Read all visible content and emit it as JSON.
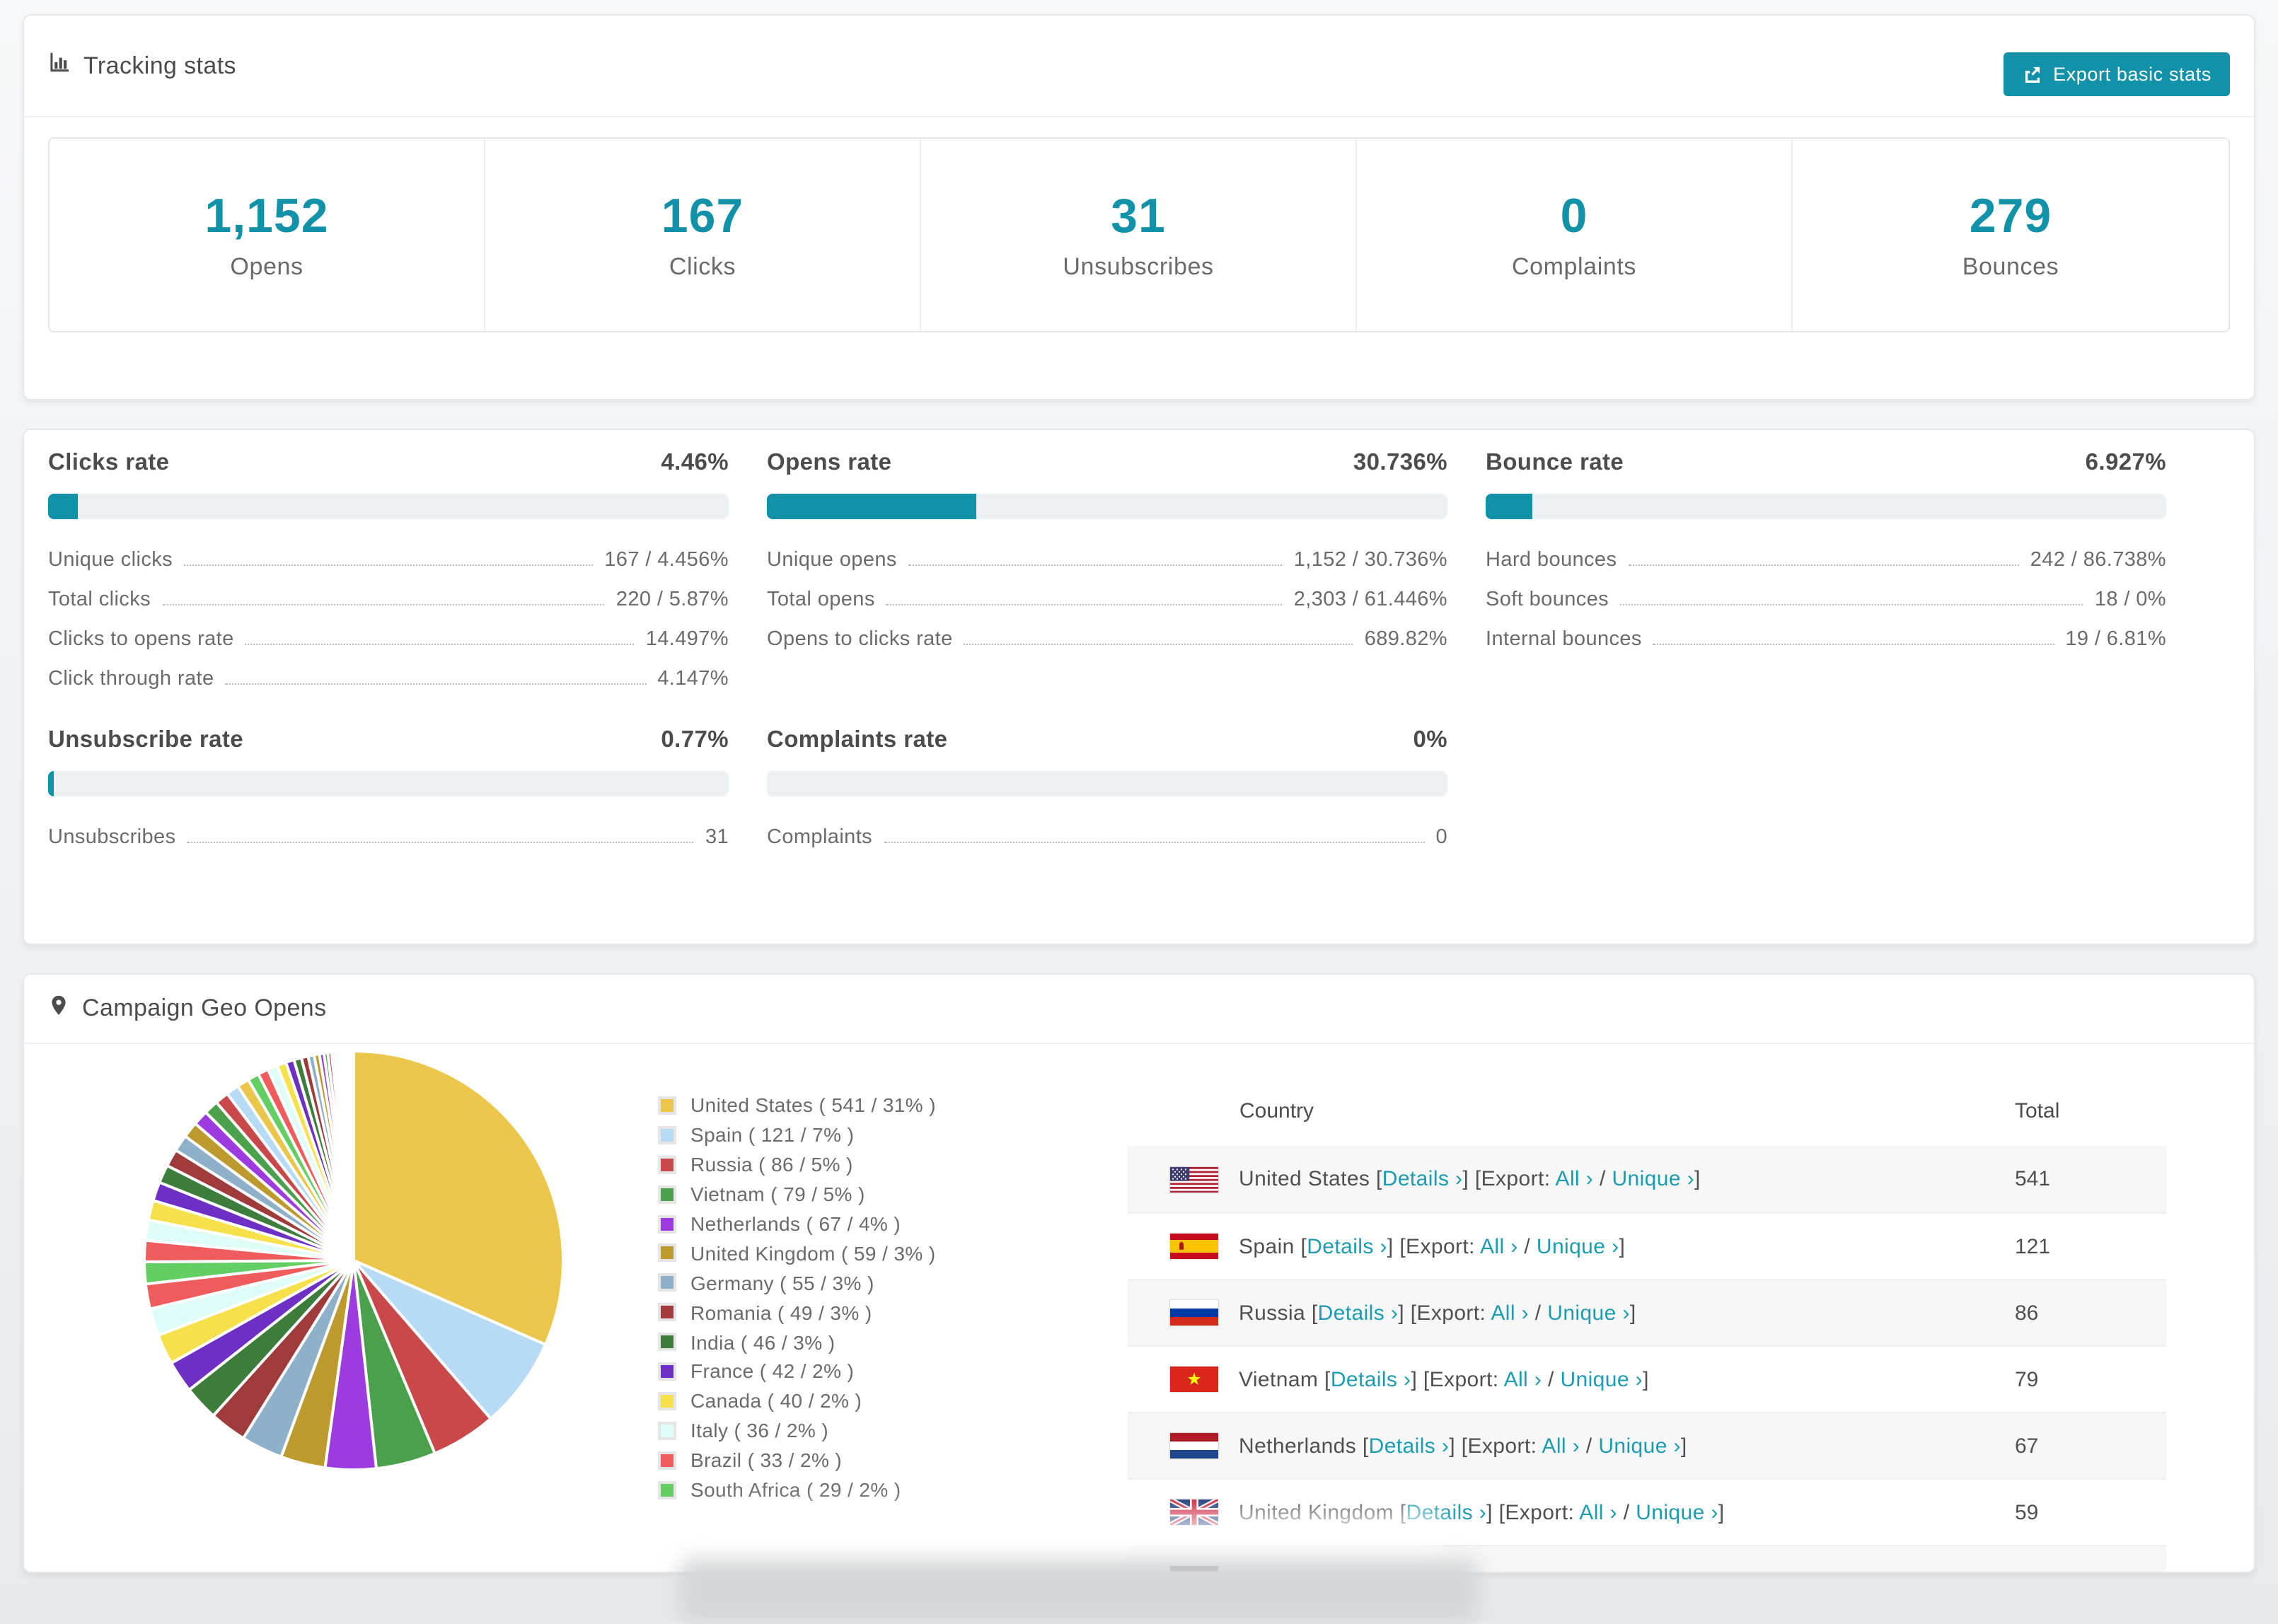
{
  "colors": {
    "accent": "#1192a8",
    "link": "#1b9cb2",
    "bar_track": "#edf0f2",
    "text_dark": "#4b4c4e",
    "text_gray": "#6a6b6d",
    "row_alt_bg": "#f7f7f7"
  },
  "tracking_card": {
    "title": "Tracking stats",
    "icon": "bar-chart-icon",
    "export_button": {
      "label": "Export basic stats",
      "icon": "export-icon"
    },
    "stats": [
      {
        "value": "1,152",
        "label": "Opens"
      },
      {
        "value": "167",
        "label": "Clicks"
      },
      {
        "value": "31",
        "label": "Unsubscribes"
      },
      {
        "value": "0",
        "label": "Complaints"
      },
      {
        "value": "279",
        "label": "Bounces"
      }
    ]
  },
  "rates_card": {
    "sections": [
      {
        "title": "Clicks rate",
        "value": "4.46%",
        "percent": 4.46,
        "rows": [
          {
            "label": "Unique clicks",
            "value": "167 / 4.456%"
          },
          {
            "label": "Total clicks",
            "value": "220 / 5.87%"
          },
          {
            "label": "Clicks to opens rate",
            "value": "14.497%"
          },
          {
            "label": "Click through rate",
            "value": "4.147%"
          }
        ]
      },
      {
        "title": "Opens rate",
        "value": "30.736%",
        "percent": 30.736,
        "rows": [
          {
            "label": "Unique opens",
            "value": "1,152 / 30.736%"
          },
          {
            "label": "Total opens",
            "value": "2,303 / 61.446%"
          },
          {
            "label": "Opens to clicks rate",
            "value": "689.82%"
          }
        ]
      },
      {
        "title": "Bounce rate",
        "value": "6.927%",
        "percent": 6.927,
        "rows": [
          {
            "label": "Hard bounces",
            "value": "242 / 86.738%"
          },
          {
            "label": "Soft bounces",
            "value": "18 / 0%"
          },
          {
            "label": "Internal bounces",
            "value": "19 / 6.81%"
          }
        ]
      },
      {
        "title": "Unsubscribe rate",
        "value": "0.77%",
        "percent": 0.77,
        "rows": [
          {
            "label": "Unsubscribes",
            "value": "31"
          }
        ]
      },
      {
        "title": "Complaints rate",
        "value": "0%",
        "percent": 0,
        "rows": [
          {
            "label": "Complaints",
            "value": "0"
          }
        ]
      }
    ]
  },
  "geo_card": {
    "title": "Campaign Geo Opens",
    "icon": "map-pin-icon",
    "table": {
      "columns": [
        "Country",
        "Total"
      ],
      "link_labels": {
        "details": "Details ›",
        "export_prefix": "[Export:",
        "all": "All ›",
        "separator": "/",
        "unique": "Unique ›"
      },
      "rows": [
        {
          "flag": "us",
          "country": "United States",
          "total": "541"
        },
        {
          "flag": "es",
          "country": "Spain",
          "total": "121"
        },
        {
          "flag": "ru",
          "country": "Russia",
          "total": "86"
        },
        {
          "flag": "vn",
          "country": "Vietnam",
          "total": "79"
        },
        {
          "flag": "nl",
          "country": "Netherlands",
          "total": "67"
        },
        {
          "flag": "gb",
          "country": "United Kingdom",
          "total": "59"
        },
        {
          "flag": "de",
          "country": "",
          "total": "",
          "partial": true
        }
      ]
    }
  },
  "chart_data": {
    "type": "pie",
    "title": "Campaign Geo Opens",
    "legend_position": "right",
    "start_angle_deg": -90,
    "direction": "clockwise",
    "slices": [
      {
        "label": "United States",
        "value": 541,
        "pct": "31%",
        "color": "#ecc64a"
      },
      {
        "label": "Spain",
        "value": 121,
        "pct": "7%",
        "color": "#b7dbf4"
      },
      {
        "label": "Russia",
        "value": 86,
        "pct": "5%",
        "color": "#c9494b"
      },
      {
        "label": "Vietnam",
        "value": 79,
        "pct": "5%",
        "color": "#4ba04b"
      },
      {
        "label": "Netherlands",
        "value": 67,
        "pct": "4%",
        "color": "#9b3be0"
      },
      {
        "label": "United Kingdom",
        "value": 59,
        "pct": "3%",
        "color": "#bd9a2e"
      },
      {
        "label": "Germany",
        "value": 55,
        "pct": "3%",
        "color": "#8fb0c9"
      },
      {
        "label": "Romania",
        "value": 49,
        "pct": "3%",
        "color": "#a03b3b"
      },
      {
        "label": "India",
        "value": 46,
        "pct": "3%",
        "color": "#3c7d3c"
      },
      {
        "label": "France",
        "value": 42,
        "pct": "2%",
        "color": "#6d2fc4"
      },
      {
        "label": "Canada",
        "value": 40,
        "pct": "2%",
        "color": "#f6e14d"
      },
      {
        "label": "Italy",
        "value": 36,
        "pct": "2%",
        "color": "#dffdf8"
      },
      {
        "label": "Brazil",
        "value": 33,
        "pct": "2%",
        "color": "#f05b5b"
      },
      {
        "label": "South Africa",
        "value": 29,
        "pct": "2%",
        "color": "#63ce63"
      }
    ],
    "unlabeled_small_slice_values": [
      28,
      27,
      26,
      25,
      24,
      23,
      22,
      21,
      20,
      19,
      18,
      17,
      16,
      15,
      14,
      13,
      12,
      11,
      10,
      9,
      8,
      7,
      6,
      5,
      5,
      4,
      4,
      3,
      3,
      2,
      2,
      2,
      2,
      1,
      1,
      1,
      1,
      1,
      1,
      1
    ]
  }
}
